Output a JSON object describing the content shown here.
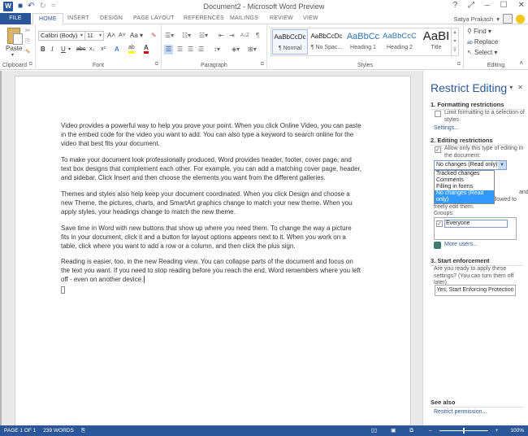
{
  "window": {
    "title": "Document2 - Microsoft Word Preview",
    "controls": [
      "?",
      "⤢",
      "–",
      "☐",
      "✕"
    ]
  },
  "qat": {
    "app_icon": "W",
    "save_icon": "💾",
    "undo_icon": "↶",
    "redo_icon": "↻",
    "customize_icon": "="
  },
  "tabs": [
    "FILE",
    "HOME",
    "INSERT",
    "DESIGN",
    "PAGE LAYOUT",
    "REFERENCES",
    "MAILINGS",
    "REVIEW",
    "VIEW"
  ],
  "active_tab": "HOME",
  "user": {
    "name": "Satya Prakash",
    "chevron": "▾"
  },
  "ribbon": {
    "clipboard": {
      "label": "Clipboard",
      "paste": "Paste",
      "cut": "✂",
      "copy": "⎘",
      "format_painter": "🖌",
      "paste_arrow": "▾"
    },
    "font": {
      "label": "Font",
      "font_name": "Calibri (Body)",
      "font_size": "11",
      "grow": "A˄",
      "shrink": "A˅",
      "change_case": "Aa ▾",
      "clear_format": "✎",
      "bold": "B",
      "italic": "I",
      "underline": "U",
      "strike": "abc",
      "subscript": "x₂",
      "superscript": "x²",
      "text_effects": "A",
      "highlight": "ab",
      "font_color": "A",
      "highlight_color": "#ffff00",
      "font_color_value": "#e00000"
    },
    "paragraph": {
      "label": "Paragraph",
      "bullets": "☰",
      "numbering": "☷",
      "multilevel": "☱",
      "decrease_indent": "⇤",
      "increase_indent": "⇥",
      "sort": "A↓Z",
      "show_marks": "¶",
      "align_left": "☰",
      "center": "☰",
      "align_right": "☰",
      "justify": "☰",
      "line_spacing": "↕",
      "shading": "◈",
      "borders": "⊞"
    },
    "styles": {
      "label": "Styles",
      "items": [
        {
          "sample": "AaBbCcDc",
          "name": "¶ Normal",
          "color": "#222222",
          "selected": true
        },
        {
          "sample": "AaBbCcDc",
          "name": "¶ No Spac...",
          "color": "#222222",
          "selected": false
        },
        {
          "sample": "AaBbCc",
          "name": "Heading 1",
          "color": "#2e74b5",
          "selected": false
        },
        {
          "sample": "AaBbCcC",
          "name": "Heading 2",
          "color": "#2e74b5",
          "selected": false
        },
        {
          "sample": "AaBI",
          "name": "Title",
          "color": "#222222",
          "selected": false
        }
      ],
      "scroll_up": "▴",
      "scroll_down": "▾",
      "more": "⊽"
    },
    "editing": {
      "label": "Editing",
      "find": "Find ▾",
      "replace": "Replace",
      "select": "Select ▾",
      "find_icon": "🔍",
      "replace_icon": "ab→ac",
      "select_icon": "↖",
      "collapse": "˄"
    }
  },
  "document": {
    "paragraphs": [
      "Video provides a powerful way to help you prove your point. When you click Online Video, you can paste in the embed code for the video you want to add. You can also type a keyword to search online for the video that best fits your document.",
      "To make your document look professionally produced, Word provides header, footer, cover page, and text box designs that complement each other. For example, you can add a matching cover page, header, and sidebar. Click Insert and then choose the elements you want from the different galleries.",
      "Themes and styles also help keep your document coordinated. When you click Design and choose a new Theme, the pictures, charts, and SmartArt graphics change to match your new theme. When you apply styles, your headings change to match the new theme.",
      "Save time in Word with new buttons that show up where you need them. To change the way a picture fits in your document, click it and a button for layout options appears next to it. When you work on a table, click where you want to add a row or a column, and then click the plus sign.",
      "Reading is easier, too, in the new Reading view. You can collapse parts of the document and focus on the text you want. If you need to stop reading before you reach the end, Word remembers where you left off - even on another device."
    ]
  },
  "pane": {
    "title": "Restrict Editing",
    "menu_icon": "▾",
    "close_icon": "✕",
    "section1": {
      "heading": "1. Formatting restrictions",
      "checkbox_label": "Limit formatting to a selection of styles",
      "checked": false,
      "settings_link": "Settings..."
    },
    "section2": {
      "heading": "2. Editing restrictions",
      "checkbox_label": "Allow only this type of editing in the document:",
      "checked": true,
      "dropdown_value": "No changes (Read only)",
      "dropdown_options": [
        "Tracked changes",
        "Comments",
        "Filling in forms",
        "No changes (Read only)"
      ],
      "dropdown_selected_index": 3,
      "exceptions_text": "choose users who are allowed to freely edit them.",
      "exceptions_partial": "and",
      "groups_label": "Groups:",
      "groups": [
        {
          "name": "Everyone",
          "checked": true
        }
      ],
      "more_users": "More users..."
    },
    "section3": {
      "heading": "3. Start enforcement",
      "text": "Are you ready to apply these settings? (You can turn them off later)",
      "button": "Yes, Start Enforcing Protection"
    },
    "see_also": {
      "heading": "See also",
      "link": "Restrict permission..."
    }
  },
  "status": {
    "page": "PAGE 1 OF 1",
    "words": "239 WORDS",
    "proofing_icon": "📖",
    "view_read": "📖",
    "view_print": "▤",
    "view_web": "🗔",
    "zoom_minus": "–",
    "zoom_plus": "+",
    "zoom_level": "100%",
    "zoom_fraction": 0.5
  }
}
